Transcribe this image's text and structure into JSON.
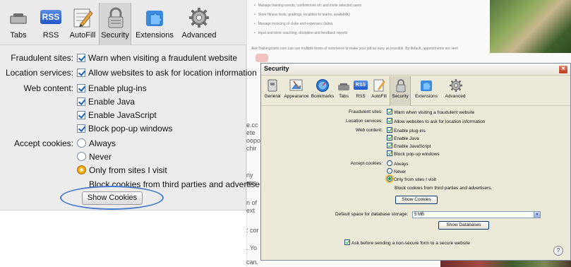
{
  "left_panel": {
    "toolbar": [
      {
        "id": "tabs",
        "label": "Tabs",
        "icon": "tabs-icon"
      },
      {
        "id": "rss",
        "label": "RSS",
        "icon": "rss-icon"
      },
      {
        "id": "autofill",
        "label": "AutoFill",
        "icon": "autofill-icon"
      },
      {
        "id": "security",
        "label": "Security",
        "icon": "lock-icon",
        "selected": true
      },
      {
        "id": "extensions",
        "label": "Extensions",
        "icon": "extensions-icon"
      },
      {
        "id": "advanced",
        "label": "Advanced",
        "icon": "gear-icon"
      }
    ],
    "rss_badge": "RSS",
    "fraudulent": {
      "label": "Fraudulent sites:",
      "option": "Warn when visiting a fraudulent website"
    },
    "location": {
      "label": "Location services:",
      "option": "Allow websites to ask for location information"
    },
    "web_content": {
      "label": "Web content:",
      "options": [
        "Enable plug-ins",
        "Enable Java",
        "Enable JavaScript",
        "Block pop-up windows"
      ]
    },
    "cookies": {
      "label": "Accept cookies:",
      "options": [
        "Always",
        "Never",
        "Only from sites I visit"
      ],
      "selected": "Only from sites I visit",
      "note": "Block cookies from third parties and advertisers.",
      "button": "Show Cookies"
    }
  },
  "background_page": {
    "bullets": [
      "Manage training events, conferences etc and invite selected users",
      "Store fitness tests, gradings, localities to teams, availability",
      "Manage invoicing of clubs and expenses claims",
      "Input and store coaching, discipline and feedback reports"
    ],
    "paragraph": "AlecTrainingcoms.com can use multiple forms of commerce to make your job as easy as possible. By default, appointments are sent",
    "snippets": [
      "e.cc",
      "ete",
      "oopo",
      "chir",
      "ny",
      "ass",
      "n of",
      "ext",
      ": cor",
      ". Yo",
      "can."
    ]
  },
  "dialog": {
    "title": "Security",
    "close": "×",
    "toolbar": [
      {
        "id": "general",
        "label": "General",
        "icon": "general-icon"
      },
      {
        "id": "appearance",
        "label": "Appearance",
        "icon": "appearance-icon"
      },
      {
        "id": "bookmarks",
        "label": "Bookmarks",
        "icon": "bookmarks-icon"
      },
      {
        "id": "tabs",
        "label": "Tabs",
        "icon": "tabs-icon"
      },
      {
        "id": "rss",
        "label": "RSS",
        "icon": "rss-icon"
      },
      {
        "id": "autofill",
        "label": "AutoFill",
        "icon": "autofill-icon"
      },
      {
        "id": "security",
        "label": "Security",
        "icon": "lock-icon",
        "selected": true
      },
      {
        "id": "extensions",
        "label": "Extensions",
        "icon": "extensions-icon"
      },
      {
        "id": "advanced",
        "label": "Advanced",
        "icon": "gear-icon"
      }
    ],
    "rss_badge": "RSS",
    "fraudulent": {
      "label": "Fraudulent sites:",
      "option": "Warn when visiting a fraudulent website"
    },
    "location": {
      "label": "Location services:",
      "option": "Allow websites to ask for location information"
    },
    "web_content": {
      "label": "Web content:",
      "options": [
        "Enable plug-ins",
        "Enable Java",
        "Enable JavaScript",
        "Block pop-up windows"
      ]
    },
    "cookies": {
      "label": "Accept cookies:",
      "options": [
        "Always",
        "Never",
        "Only from sites I visit"
      ],
      "selected": "Only from sites I visit",
      "note": "Block cookies from third parties and advertisers.",
      "button": "Show Cookies"
    },
    "database": {
      "label": "Default space for database storage:",
      "value": "5 MB",
      "button": "Show Databases"
    },
    "nonsecure": {
      "option": "Ask before sending a non-secure form to a secure website"
    },
    "help": "?"
  },
  "colors": {
    "highlight": "#4a7ccc",
    "panel_bg": "#ececec",
    "dialog_bg": "#ece9d8",
    "xp_close": "#c0391b"
  }
}
